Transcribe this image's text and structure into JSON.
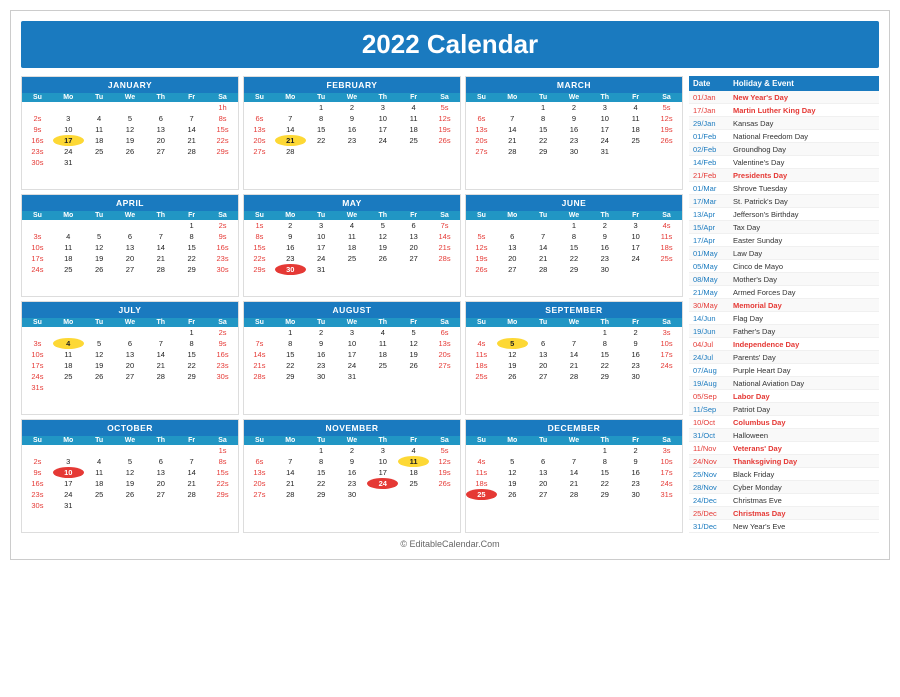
{
  "title": "2022 Calendar",
  "months": [
    {
      "name": "JANUARY",
      "days_header": [
        "Su",
        "Mo",
        "Tu",
        "We",
        "Th",
        "Fr",
        "Sa"
      ],
      "weeks": [
        [
          null,
          null,
          null,
          null,
          null,
          null,
          "1h"
        ],
        [
          "2s",
          "3",
          "4",
          "5",
          "6",
          "7",
          "8s"
        ],
        [
          "9s",
          "10",
          "11",
          "12",
          "13",
          "14",
          "15s"
        ],
        [
          "16s",
          "17hl",
          "18",
          "19",
          "20",
          "21",
          "22s"
        ],
        [
          "23s",
          "24",
          "25",
          "26",
          "27",
          "28",
          "29s"
        ],
        [
          "30s",
          "31",
          null,
          null,
          null,
          null,
          null
        ]
      ]
    },
    {
      "name": "FEBRUARY",
      "days_header": [
        "Su",
        "Mo",
        "Tu",
        "We",
        "Th",
        "Fr",
        "Sa"
      ],
      "weeks": [
        [
          null,
          null,
          "1",
          "2",
          "3",
          "4",
          "5s"
        ],
        [
          "6s",
          "7",
          "8",
          "9",
          "10",
          "11",
          "12s"
        ],
        [
          "13s",
          "14",
          "15",
          "16",
          "17",
          "18",
          "19s"
        ],
        [
          "20s",
          "21hl",
          "22",
          "23",
          "24",
          "25",
          "26s"
        ],
        [
          "27s",
          "28",
          null,
          null,
          null,
          null,
          null
        ]
      ]
    },
    {
      "name": "MARCH",
      "days_header": [
        "Su",
        "Mo",
        "Tu",
        "We",
        "Th",
        "Fr",
        "Sa"
      ],
      "weeks": [
        [
          null,
          null,
          "1",
          "2",
          "3",
          "4",
          "5s"
        ],
        [
          "6s",
          "7",
          "8",
          "9",
          "10",
          "11",
          "12s"
        ],
        [
          "13s",
          "14",
          "15",
          "16",
          "17",
          "18",
          "19s"
        ],
        [
          "20s",
          "21",
          "22",
          "23",
          "24",
          "25",
          "26s"
        ],
        [
          "27s",
          "28",
          "29",
          "30",
          "31",
          null,
          null
        ]
      ]
    },
    {
      "name": "APRIL",
      "days_header": [
        "Su",
        "Mo",
        "Tu",
        "We",
        "Th",
        "Fr",
        "Sa"
      ],
      "weeks": [
        [
          null,
          null,
          null,
          null,
          null,
          "1",
          "2s"
        ],
        [
          "3s",
          "4",
          "5",
          "6",
          "7",
          "8",
          "9s"
        ],
        [
          "10s",
          "11",
          "12",
          "13",
          "14",
          "15",
          "16s"
        ],
        [
          "17s",
          "18",
          "19",
          "20",
          "21",
          "22",
          "23s"
        ],
        [
          "24s",
          "25",
          "26",
          "27",
          "28",
          "29",
          "30s"
        ]
      ]
    },
    {
      "name": "MAY",
      "days_header": [
        "Su",
        "Mo",
        "Tu",
        "We",
        "Th",
        "Fr",
        "Sa"
      ],
      "weeks": [
        [
          "1s",
          "2",
          "3",
          "4",
          "5",
          "6",
          "7s"
        ],
        [
          "8s",
          "9",
          "10",
          "11",
          "12",
          "13",
          "14s"
        ],
        [
          "15s",
          "16",
          "17",
          "18",
          "19",
          "20",
          "21s"
        ],
        [
          "22s",
          "23",
          "24",
          "25",
          "26",
          "27",
          "28s"
        ],
        [
          "29s",
          "30hlr",
          "31",
          null,
          null,
          null,
          null
        ]
      ]
    },
    {
      "name": "JUNE",
      "days_header": [
        "Su",
        "Mo",
        "Tu",
        "We",
        "Th",
        "Fr",
        "Sa"
      ],
      "weeks": [
        [
          null,
          null,
          null,
          "1",
          "2",
          "3",
          "4s"
        ],
        [
          "5s",
          "6",
          "7",
          "8",
          "9",
          "10",
          "11s"
        ],
        [
          "12s",
          "13",
          "14",
          "15",
          "16",
          "17",
          "18s"
        ],
        [
          "19s",
          "20",
          "21",
          "22",
          "23",
          "24",
          "25s"
        ],
        [
          "26s",
          "27",
          "28",
          "29",
          "30",
          null,
          null
        ]
      ]
    },
    {
      "name": "JULY",
      "days_header": [
        "Su",
        "Mo",
        "Tu",
        "We",
        "Th",
        "Fr",
        "Sa"
      ],
      "weeks": [
        [
          null,
          null,
          null,
          null,
          null,
          "1",
          "2s"
        ],
        [
          "3s",
          "4hl",
          "5",
          "6",
          "7",
          "8",
          "9s"
        ],
        [
          "10s",
          "11",
          "12",
          "13",
          "14",
          "15",
          "16s"
        ],
        [
          "17s",
          "18",
          "19",
          "20",
          "21",
          "22",
          "23s"
        ],
        [
          "24s",
          "25",
          "26",
          "27",
          "28",
          "29",
          "30s"
        ],
        [
          "31s",
          null,
          null,
          null,
          null,
          null,
          null
        ]
      ]
    },
    {
      "name": "AUGUST",
      "days_header": [
        "Su",
        "Mo",
        "Tu",
        "We",
        "Th",
        "Fr",
        "Sa"
      ],
      "weeks": [
        [
          null,
          "1",
          "2",
          "3",
          "4",
          "5",
          "6s"
        ],
        [
          "7s",
          "8",
          "9",
          "10",
          "11",
          "12",
          "13s"
        ],
        [
          "14s",
          "15",
          "16",
          "17",
          "18",
          "19",
          "20s"
        ],
        [
          "21s",
          "22",
          "23",
          "24",
          "25",
          "26",
          "27s"
        ],
        [
          "28s",
          "29",
          "30",
          "31",
          null,
          null,
          null
        ]
      ]
    },
    {
      "name": "SEPTEMBER",
      "days_header": [
        "Su",
        "Mo",
        "Tu",
        "We",
        "Th",
        "Fr",
        "Sa"
      ],
      "weeks": [
        [
          null,
          null,
          null,
          null,
          "1",
          "2",
          "3s"
        ],
        [
          "4s",
          "5hl",
          "6",
          "7",
          "8",
          "9",
          "10s"
        ],
        [
          "11s",
          "12",
          "13",
          "14",
          "15",
          "16",
          "17s"
        ],
        [
          "18s",
          "19",
          "20",
          "21",
          "22",
          "23",
          "24s"
        ],
        [
          "25s",
          "26",
          "27",
          "28",
          "29",
          "30",
          null
        ]
      ]
    },
    {
      "name": "OCTOBER",
      "days_header": [
        "Su",
        "Mo",
        "Tu",
        "We",
        "Th",
        "Fr",
        "Sa"
      ],
      "weeks": [
        [
          null,
          null,
          null,
          null,
          null,
          null,
          "1s"
        ],
        [
          "2s",
          "3",
          "4",
          "5",
          "6",
          "7",
          "8s"
        ],
        [
          "9s",
          "10hlr",
          "11",
          "12",
          "13",
          "14",
          "15s"
        ],
        [
          "16s",
          "17",
          "18",
          "19",
          "20",
          "21",
          "22s"
        ],
        [
          "23s",
          "24",
          "25",
          "26",
          "27",
          "28",
          "29s"
        ],
        [
          "30s",
          "31",
          null,
          null,
          null,
          null,
          null
        ]
      ]
    },
    {
      "name": "NOVEMBER",
      "days_header": [
        "Su",
        "Mo",
        "Tu",
        "We",
        "Th",
        "Fr",
        "Sa"
      ],
      "weeks": [
        [
          null,
          null,
          "1",
          "2",
          "3",
          "4",
          "5s"
        ],
        [
          "6s",
          "7",
          "8",
          "9",
          "10",
          "11hl",
          "12s"
        ],
        [
          "13s",
          "14",
          "15",
          "16",
          "17",
          "18",
          "19s"
        ],
        [
          "20s",
          "21",
          "22",
          "23",
          "24hlr",
          "25",
          "26s"
        ],
        [
          "27s",
          "28",
          "29",
          "30",
          null,
          null,
          null
        ]
      ]
    },
    {
      "name": "DECEMBER",
      "days_header": [
        "Su",
        "Mo",
        "Tu",
        "We",
        "Th",
        "Fr",
        "Sa"
      ],
      "weeks": [
        [
          null,
          null,
          null,
          null,
          "1",
          "2",
          "3s"
        ],
        [
          "4s",
          "5",
          "6",
          "7",
          "8",
          "9",
          "10s"
        ],
        [
          "11s",
          "12",
          "13",
          "14",
          "15",
          "16",
          "17s"
        ],
        [
          "18s",
          "19",
          "20",
          "21",
          "22",
          "23",
          "24s"
        ],
        [
          "25hlr",
          "26",
          "27",
          "28",
          "29",
          "30",
          "31s"
        ]
      ]
    }
  ],
  "holidays": [
    {
      "date": "01/Jan",
      "name": "New Year's Day",
      "red": true
    },
    {
      "date": "17/Jan",
      "name": "Martin Luther King Day",
      "red": true
    },
    {
      "date": "29/Jan",
      "name": "Kansas Day",
      "red": false
    },
    {
      "date": "01/Feb",
      "name": "National Freedom Day",
      "red": false
    },
    {
      "date": "02/Feb",
      "name": "Groundhog Day",
      "red": false
    },
    {
      "date": "14/Feb",
      "name": "Valentine's Day",
      "red": false
    },
    {
      "date": "21/Feb",
      "name": "Presidents Day",
      "red": true
    },
    {
      "date": "01/Mar",
      "name": "Shrove Tuesday",
      "red": false
    },
    {
      "date": "17/Mar",
      "name": "St. Patrick's Day",
      "red": false
    },
    {
      "date": "13/Apr",
      "name": "Jefferson's Birthday",
      "red": false
    },
    {
      "date": "15/Apr",
      "name": "Tax Day",
      "red": false
    },
    {
      "date": "17/Apr",
      "name": "Easter Sunday",
      "red": false
    },
    {
      "date": "01/May",
      "name": "Law Day",
      "red": false
    },
    {
      "date": "05/May",
      "name": "Cinco de Mayo",
      "red": false
    },
    {
      "date": "08/May",
      "name": "Mother's Day",
      "red": false
    },
    {
      "date": "21/May",
      "name": "Armed Forces Day",
      "red": false
    },
    {
      "date": "30/May",
      "name": "Memorial Day",
      "red": true
    },
    {
      "date": "14/Jun",
      "name": "Flag Day",
      "red": false
    },
    {
      "date": "19/Jun",
      "name": "Father's Day",
      "red": false
    },
    {
      "date": "04/Jul",
      "name": "Independence Day",
      "red": true
    },
    {
      "date": "24/Jul",
      "name": "Parents' Day",
      "red": false
    },
    {
      "date": "07/Aug",
      "name": "Purple Heart Day",
      "red": false
    },
    {
      "date": "19/Aug",
      "name": "National Aviation Day",
      "red": false
    },
    {
      "date": "05/Sep",
      "name": "Labor Day",
      "red": true
    },
    {
      "date": "11/Sep",
      "name": "Patriot Day",
      "red": false
    },
    {
      "date": "10/Oct",
      "name": "Columbus Day",
      "red": true
    },
    {
      "date": "31/Oct",
      "name": "Halloween",
      "red": false
    },
    {
      "date": "11/Nov",
      "name": "Veterans' Day",
      "red": true
    },
    {
      "date": "24/Nov",
      "name": "Thanksgiving Day",
      "red": true
    },
    {
      "date": "25/Nov",
      "name": "Black Friday",
      "red": false
    },
    {
      "date": "28/Nov",
      "name": "Cyber Monday",
      "red": false
    },
    {
      "date": "24/Dec",
      "name": "Christmas Eve",
      "red": false
    },
    {
      "date": "25/Dec",
      "name": "Christmas Day",
      "red": true
    },
    {
      "date": "31/Dec",
      "name": "New Year's Eve",
      "red": false
    }
  ],
  "footer": "© EditableCalendar.Com"
}
